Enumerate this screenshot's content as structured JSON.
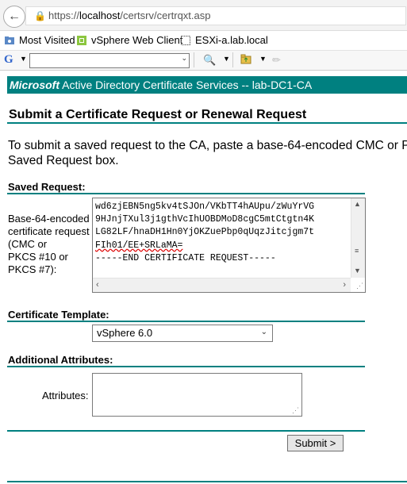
{
  "browser": {
    "url_scheme": "https://",
    "url_host": "localhost",
    "url_path": "/certsrv/certrqxt.asp",
    "favorites": [
      "Most Visited",
      "vSphere Web Client",
      "ESXi-a.lab.local"
    ],
    "toolbar_logo": "G"
  },
  "banner": {
    "brand": "Microsoft",
    "title": "Active Directory Certificate Services  --  lab-DC1-CA"
  },
  "page": {
    "heading": "Submit a Certificate Request or Renewal Request",
    "intro_line1": "To submit a saved request to the CA, paste a base-64-encoded CMC or P",
    "intro_line2": "Saved Request box."
  },
  "saved_request": {
    "section_title": "Saved Request:",
    "label_lines": [
      "Base-64-encoded",
      "certificate request",
      "(CMC or",
      "PKCS #10 or",
      "PKCS #7):"
    ],
    "content_lines": [
      "wd6zjEBN5ng5kv4tSJOn/VKbTT4hAUpu/zWuYrVG",
      "9HJnjTXul3j1gthVcIhUOBDMoD8cgC5mtCtgtn4K",
      "LG82LF/hnaDH1Hn0YjOKZuePbp0qUqzJitcjgm7t",
      "FIh01/EE+SRLaMA=",
      "-----END CERTIFICATE REQUEST-----"
    ]
  },
  "template": {
    "section_title": "Certificate Template:",
    "selected": "vSphere 6.0"
  },
  "attributes": {
    "section_title": "Additional Attributes:",
    "label": "Attributes:",
    "value": ""
  },
  "actions": {
    "submit_label": "Submit >"
  },
  "colors": {
    "accent": "#008080"
  }
}
